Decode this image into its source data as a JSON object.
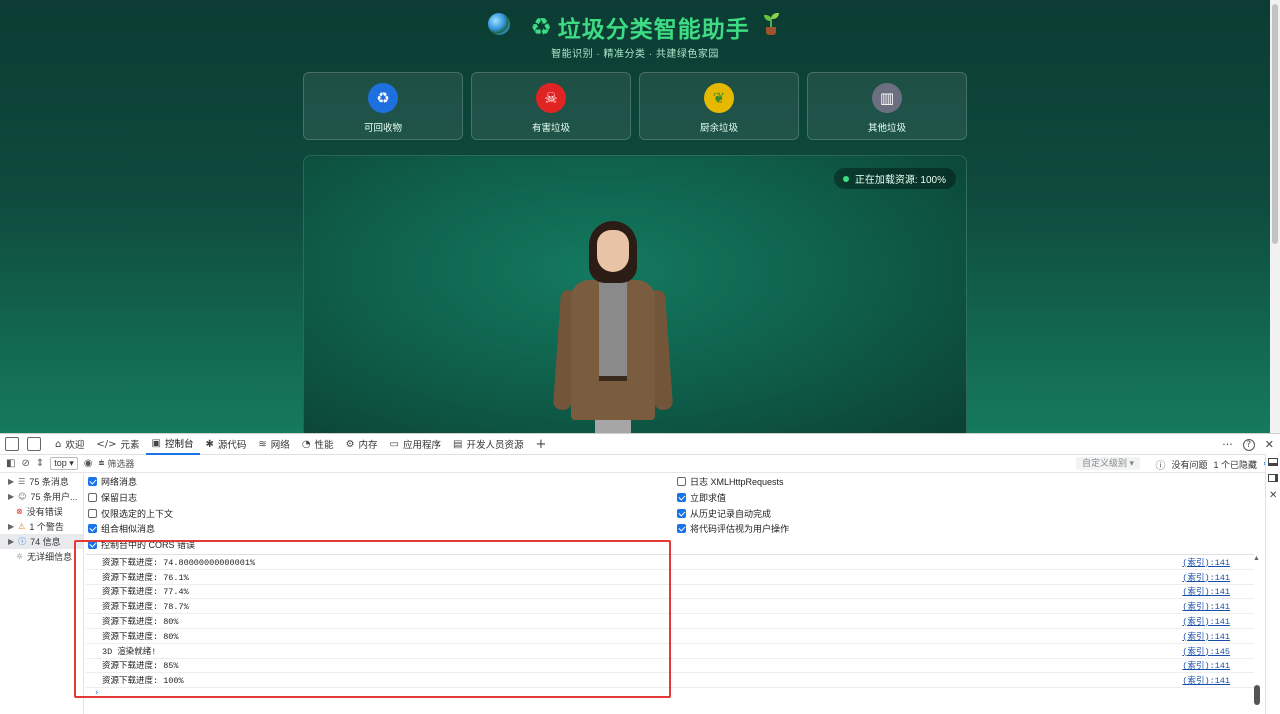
{
  "page": {
    "title": "垃圾分类智能助手",
    "title_icon": "♻",
    "subtitle": "智能识别 · 精准分类 · 共建绿色家园",
    "categories": [
      {
        "label": "可回收物",
        "icon": "♻",
        "color": "#1e6fe0"
      },
      {
        "label": "有害垃圾",
        "icon": "☠",
        "color": "#e02424"
      },
      {
        "label": "厨余垃圾",
        "icon": "❦",
        "color": "#e6b800"
      },
      {
        "label": "其他垃圾",
        "icon": "▥",
        "color": "#6b6f80"
      }
    ],
    "loading_status": "正在加载资源: 100%"
  },
  "devtools": {
    "tabs": [
      {
        "label": "欢迎",
        "icon": "⌂"
      },
      {
        "label": "元素",
        "icon": "</>"
      },
      {
        "label": "控制台",
        "icon": "▣"
      },
      {
        "label": "源代码",
        "icon": "✱"
      },
      {
        "label": "网络",
        "icon": "≋"
      },
      {
        "label": "性能",
        "icon": "◔"
      },
      {
        "label": "内存",
        "icon": "⚙"
      },
      {
        "label": "应用程序",
        "icon": "▭"
      },
      {
        "label": "开发人员资源",
        "icon": "▤"
      }
    ],
    "add_tab": "+",
    "more": "···",
    "help": "?",
    "close": "✕",
    "toolbar": {
      "context": "top",
      "filter_placeholder": "筛选器",
      "levels": "自定义级别 ▾",
      "no_issues": "没有问题",
      "hidden": "1 个已隐藏"
    },
    "sidebar": [
      {
        "label": "75 条消息",
        "icon": "☰"
      },
      {
        "label": "75 条用户...",
        "icon": "☺"
      },
      {
        "label": "没有错误",
        "icon": "⊗"
      },
      {
        "label": "1 个警告",
        "icon": "⚠"
      },
      {
        "label": "74 信息",
        "icon": "ⓘ"
      },
      {
        "label": "无详细信息",
        "icon": "☼"
      }
    ],
    "settings_left": [
      {
        "label": "网络消息",
        "checked": true
      },
      {
        "label": "保留日志",
        "checked": false
      },
      {
        "label": "仅限选定的上下文",
        "checked": false
      },
      {
        "label": "组合相似消息",
        "checked": true
      },
      {
        "label": "控制台中的 CORS 错误",
        "checked": true
      }
    ],
    "settings_right": [
      {
        "label": "日志 XMLHttpRequests",
        "checked": false
      },
      {
        "label": "立即求值",
        "checked": true
      },
      {
        "label": "从历史记录自动完成",
        "checked": true
      },
      {
        "label": "将代码评估视为用户操作",
        "checked": true
      }
    ],
    "log": [
      {
        "text": "资源下载进度: 74.80000000000001%",
        "source": "(索引):141"
      },
      {
        "text": "资源下载进度: 76.1%",
        "source": "(索引):141"
      },
      {
        "text": "资源下载进度: 77.4%",
        "source": "(索引):141"
      },
      {
        "text": "资源下载进度: 78.7%",
        "source": "(索引):141"
      },
      {
        "text": "资源下载进度: 80%",
        "source": "(索引):141"
      },
      {
        "text": "资源下载进度: 80%",
        "source": "(索引):141"
      },
      {
        "text": "3D 渲染就绪!",
        "source": "(索引):145"
      },
      {
        "text": "资源下载进度: 85%",
        "source": "(索引):141"
      },
      {
        "text": "资源下载进度: 100%",
        "source": "(索引):141"
      }
    ],
    "prompt": "›"
  }
}
